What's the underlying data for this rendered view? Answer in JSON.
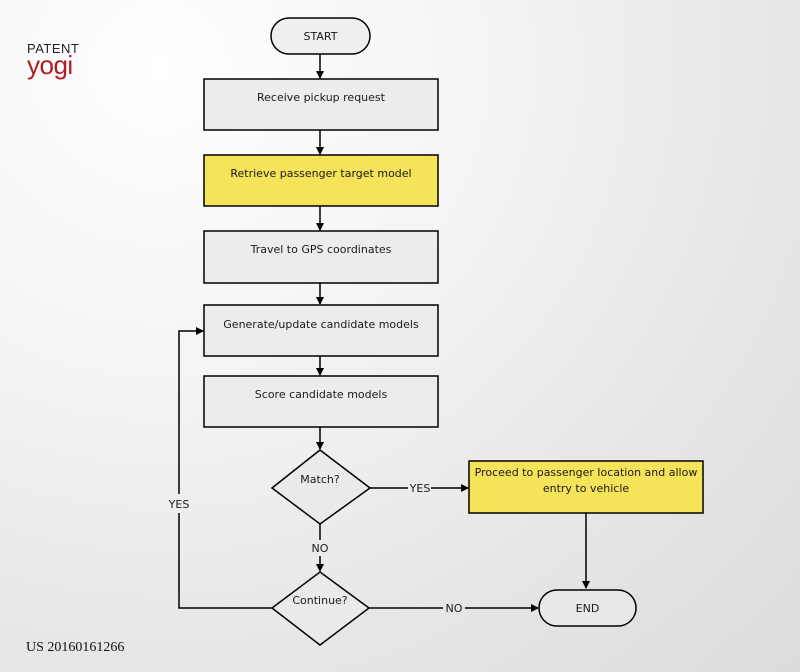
{
  "branding": {
    "patent_label": "PATENT",
    "yogi_label": "yogi",
    "brand_color": "#b01e23"
  },
  "patent_number": "US 20160161266",
  "colors": {
    "highlight_fill": "#f5e35a",
    "box_fill": "#ececec",
    "stroke": "#000000"
  },
  "flowchart": {
    "start": "START",
    "steps": {
      "receive": "Receive pickup request",
      "retrieve": "Retrieve passenger target model",
      "travel": "Travel to GPS coordinates",
      "generate": "Generate/update candidate models",
      "score": "Score candidate models",
      "proceed_line1": "Proceed to passenger location and allow",
      "proceed_line2": "entry to vehicle"
    },
    "decisions": {
      "match": "Match?",
      "continue": "Continue?"
    },
    "edge_labels": {
      "match_yes": "YES",
      "match_no": "NO",
      "continue_yes": "YES",
      "continue_no": "NO"
    },
    "end": "END"
  }
}
